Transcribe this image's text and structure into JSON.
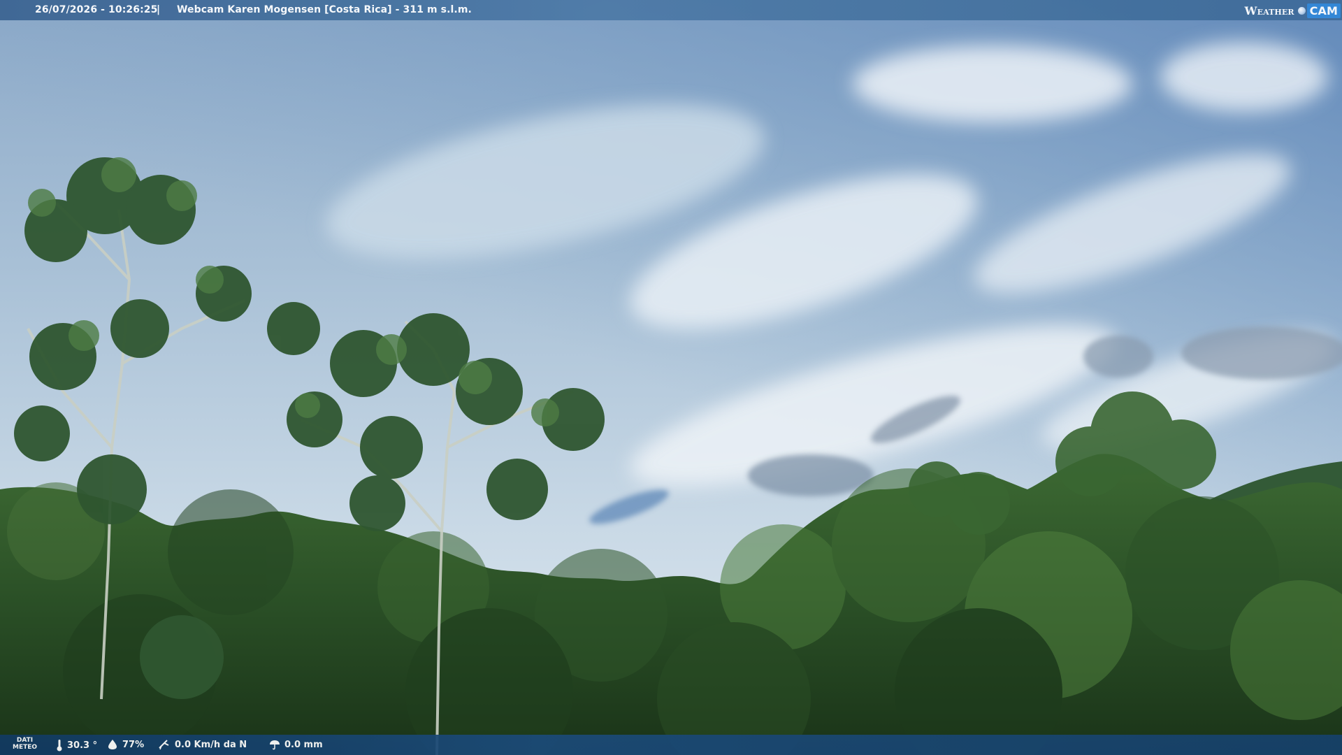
{
  "header": {
    "timestamp": "26/07/2026 - 10:26:25",
    "separator": "|",
    "title": "Webcam Karen Mogensen [Costa Rica] - 311 m s.l.m."
  },
  "logo": {
    "word": "Weather",
    "cam": "CAM"
  },
  "footer": {
    "label_line1": "DATI",
    "label_line2": "METEO",
    "temperature": "30.3 °",
    "humidity": "77%",
    "wind": "0.0 Km/h da N",
    "rain": "0.0 mm"
  },
  "colors": {
    "sky_top": "#7f9fc0",
    "sky_bottom": "#dde7f0",
    "forest_dark": "#1d3a1c",
    "forest_light": "#4e7a3c"
  },
  "icons": [
    "thermometer-icon",
    "humidity-drop-icon",
    "wind-icon",
    "rain-umbrella-icon"
  ]
}
